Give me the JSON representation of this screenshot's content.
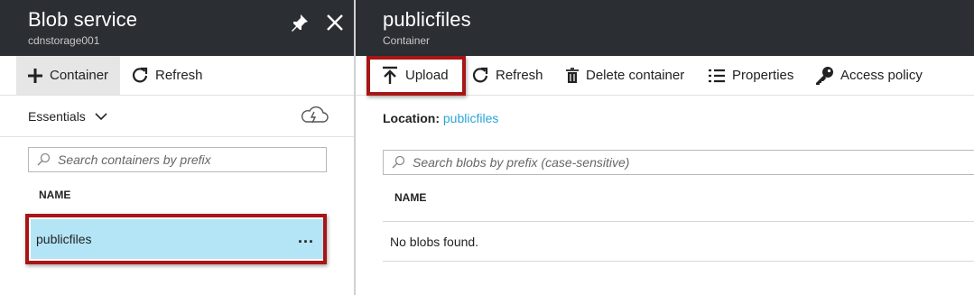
{
  "left_blade": {
    "title": "Blob service",
    "subtitle": "cdnstorage001",
    "toolbar": {
      "container_label": "Container",
      "refresh_label": "Refresh"
    },
    "essentials_label": "Essentials",
    "search": {
      "placeholder": "Search containers by prefix"
    },
    "column_header": "NAME",
    "items": [
      {
        "name": "publicfiles",
        "more_label": "..."
      }
    ]
  },
  "right_blade": {
    "title": "publicfiles",
    "subtitle": "Container",
    "toolbar": {
      "upload_label": "Upload",
      "refresh_label": "Refresh",
      "delete_label": "Delete container",
      "properties_label": "Properties",
      "access_label": "Access policy"
    },
    "location": {
      "label": "Location:",
      "value": "publicfiles"
    },
    "search": {
      "placeholder": "Search blobs by prefix (case-sensitive)"
    },
    "column_header": "NAME",
    "empty_message": "No blobs found."
  },
  "colors": {
    "header_bg": "#2b2e33",
    "selected_row": "#b3e5f6",
    "highlight": "#a81515",
    "link": "#2aa6d6"
  }
}
